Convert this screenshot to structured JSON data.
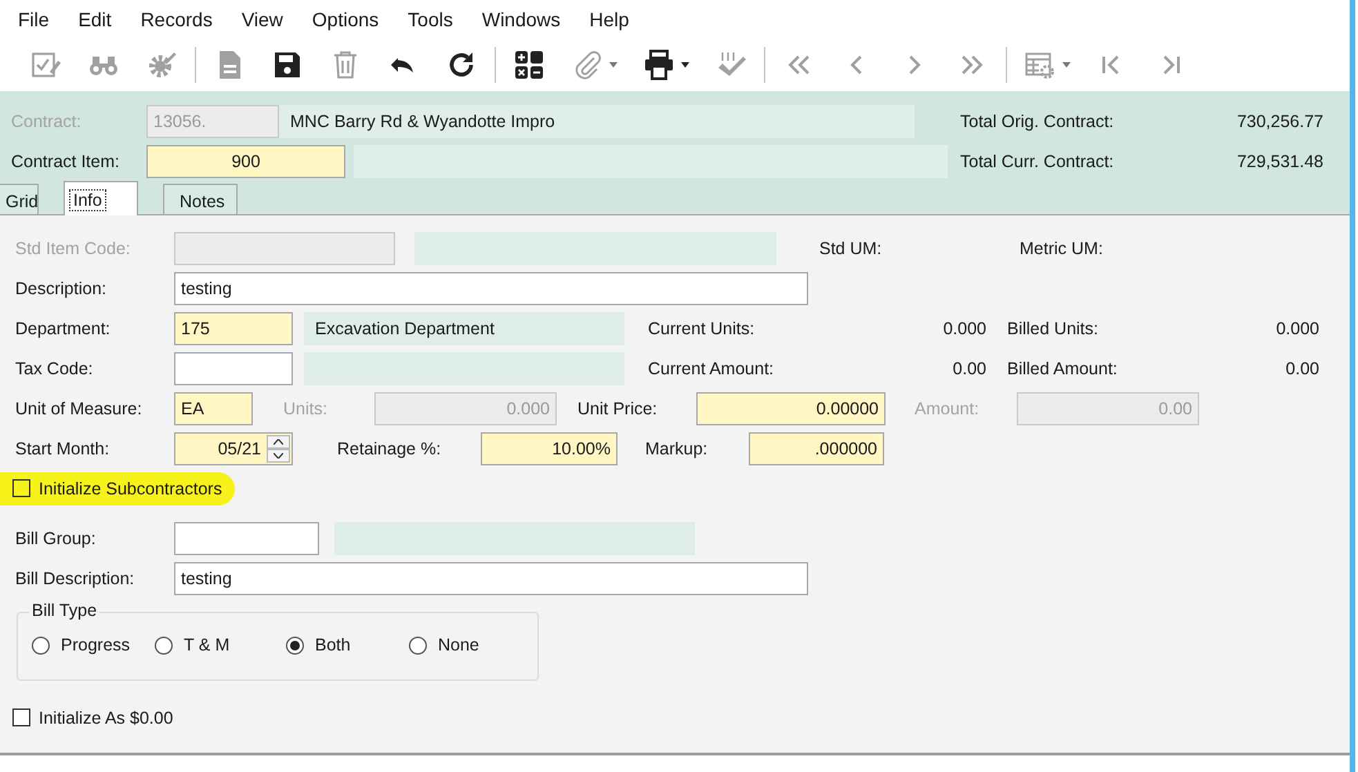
{
  "menu": [
    "File",
    "Edit",
    "Records",
    "View",
    "Options",
    "Tools",
    "Windows",
    "Help"
  ],
  "toolbar": [
    [
      {
        "disabled": true,
        "dropdown": false
      },
      {
        "disabled": true,
        "dropdown": false
      },
      {
        "disabled": true,
        "dropdown": false
      }
    ],
    [
      {
        "disabled": true,
        "dropdown": false
      },
      {
        "disabled": false,
        "dropdown": false
      },
      {
        "disabled": true,
        "dropdown": false
      },
      {
        "disabled": false,
        "dropdown": false
      },
      {
        "disabled": false,
        "dropdown": false
      }
    ],
    [
      {
        "disabled": false,
        "dropdown": false
      },
      {
        "disabled": true,
        "dropdown": true
      },
      {
        "disabled": false,
        "dropdown": true
      },
      {
        "disabled": true,
        "dropdown": false
      }
    ],
    [
      {
        "disabled": true,
        "dropdown": false
      },
      {
        "disabled": true,
        "dropdown": false
      },
      {
        "disabled": true,
        "dropdown": false
      },
      {
        "disabled": true,
        "dropdown": false
      }
    ],
    [
      {
        "disabled": true,
        "dropdown": true
      },
      {
        "disabled": true,
        "dropdown": false
      },
      {
        "disabled": true,
        "dropdown": false
      }
    ]
  ],
  "header": {
    "contract": {
      "label": "Contract:",
      "disabled": true,
      "value": "13056.",
      "description": "MNC Barry Rd & Wyandotte Impro"
    },
    "contract_item": {
      "label": "Contract Item:",
      "value": "900",
      "required": true
    },
    "totals": [
      {
        "label": "Total Orig. Contract:",
        "value": "730,256.77"
      },
      {
        "label": "Total Curr. Contract:",
        "value": "729,531.48"
      }
    ]
  },
  "tabs": [
    {
      "label": "Grid",
      "selected": false
    },
    {
      "label": "Info",
      "selected": true
    },
    {
      "label": "Notes",
      "selected": false
    }
  ],
  "form": {
    "std_item_code": {
      "label": "Std Item Code:",
      "disabled": true
    },
    "std_um": {
      "label": "Std UM:"
    },
    "metric_um": {
      "label": "Metric UM:"
    },
    "description": {
      "label": "Description:",
      "value": "testing",
      "required": false
    },
    "department": {
      "label": "Department:",
      "value": "175",
      "required": true,
      "description": "Excavation Department"
    },
    "tax_code": {
      "label": "Tax Code:",
      "required": false
    },
    "current_units": {
      "label": "Current Units:",
      "value": "0.000"
    },
    "billed_units": {
      "label": "Billed Units:",
      "value": "0.000"
    },
    "current_amount": {
      "label": "Current Amount:",
      "value": "0.00"
    },
    "billed_amount": {
      "label": "Billed Amount:",
      "value": "0.00"
    },
    "unit_of_measure": {
      "label": "Unit of Measure:",
      "value": "EA",
      "required": true
    },
    "units": {
      "label": "Units:",
      "value": "0.000",
      "disabled": true
    },
    "unit_price": {
      "label": "Unit Price:",
      "value": "0.00000",
      "required": true
    },
    "amount": {
      "label": "Amount:",
      "value": "0.00",
      "disabled": true
    },
    "start_month": {
      "label": "Start Month:",
      "value": "05/21",
      "required": true
    },
    "retainage": {
      "label": "Retainage %:",
      "value": "10.00%",
      "required": true
    },
    "markup": {
      "label": "Markup:",
      "value": ".000000",
      "required": true
    },
    "initialize_subcontractors": {
      "label": "Initialize Subcontractors",
      "checked": false,
      "highlighted": true
    },
    "bill_group": {
      "label": "Bill Group:",
      "required": false
    },
    "bill_description": {
      "label": "Bill Description:",
      "value": "testing",
      "required": false
    },
    "bill_type": {
      "title": "Bill Type",
      "options": [
        {
          "label": "Progress",
          "selected": false
        },
        {
          "label": "T & M",
          "selected": false
        },
        {
          "label": "Both",
          "selected": true
        },
        {
          "label": "None",
          "selected": false
        }
      ]
    },
    "initialize_as_zero": {
      "label": "Initialize As $0.00",
      "checked": false
    }
  }
}
